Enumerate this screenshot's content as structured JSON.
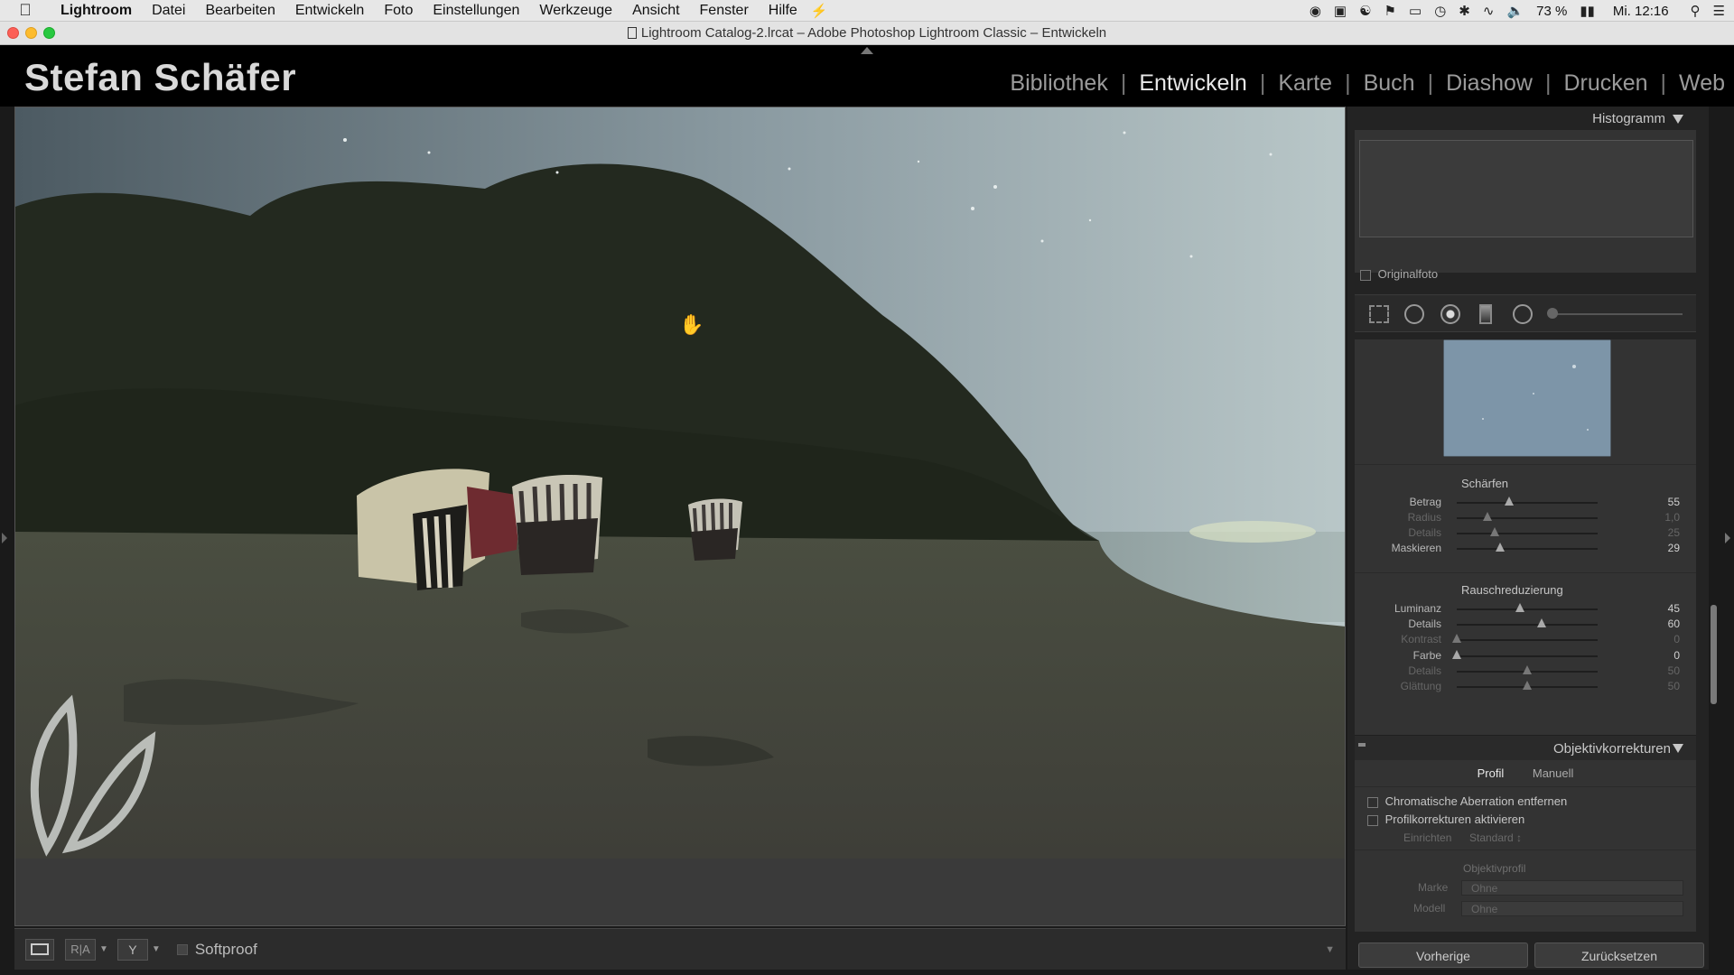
{
  "menubar": {
    "app_name": "Lightroom",
    "items": [
      "Datei",
      "Bearbeiten",
      "Entwickeln",
      "Foto",
      "Einstellungen",
      "Werkzeuge",
      "Ansicht",
      "Fenster",
      "Hilfe"
    ],
    "battery": "73 %",
    "clock": "Mi. 12:16"
  },
  "window": {
    "title": "Lightroom Catalog-2.lrcat – Adobe Photoshop Lightroom Classic – Entwickeln"
  },
  "identity_plate": "Stefan Schäfer",
  "modules": [
    {
      "label": "Bibliothek",
      "active": false
    },
    {
      "label": "Entwickeln",
      "active": true
    },
    {
      "label": "Karte",
      "active": false
    },
    {
      "label": "Buch",
      "active": false
    },
    {
      "label": "Diashow",
      "active": false
    },
    {
      "label": "Drucken",
      "active": false
    },
    {
      "label": "Web",
      "active": false
    }
  ],
  "toolbar": {
    "softproof_label": "Softproof",
    "compare_label": "R|A"
  },
  "histogram": {
    "title": "Histogramm",
    "original_photo_label": "Originalfoto"
  },
  "detail": {
    "sharpen": {
      "title": "Schärfen",
      "sliders": [
        {
          "label": "Betrag",
          "value": "55",
          "pos": 0.37,
          "dim": false
        },
        {
          "label": "Radius",
          "value": "1,0",
          "pos": 0.22,
          "dim": true
        },
        {
          "label": "Details",
          "value": "25",
          "pos": 0.27,
          "dim": true
        },
        {
          "label": "Maskieren",
          "value": "29",
          "pos": 0.31,
          "dim": false
        }
      ]
    },
    "noise": {
      "title": "Rauschreduzierung",
      "sliders": [
        {
          "label": "Luminanz",
          "value": "45",
          "pos": 0.45,
          "dim": false
        },
        {
          "label": "Details",
          "value": "60",
          "pos": 0.6,
          "dim": false
        },
        {
          "label": "Kontrast",
          "value": "0",
          "pos": 0.0,
          "dim": true
        }
      ],
      "color_sliders": [
        {
          "label": "Farbe",
          "value": "0",
          "pos": 0.0,
          "dim": false
        },
        {
          "label": "Details",
          "value": "50",
          "pos": 0.5,
          "dim": true
        },
        {
          "label": "Glättung",
          "value": "50",
          "pos": 0.5,
          "dim": true
        }
      ]
    }
  },
  "lens": {
    "title": "Objektivkorrekturen",
    "tabs": [
      {
        "label": "Profil",
        "active": true
      },
      {
        "label": "Manuell",
        "active": false
      }
    ],
    "remove_ca_label": "Chromatische Aberration entfernen",
    "enable_profile_label": "Profilkorrekturen aktivieren",
    "setup_label": "Einrichten",
    "setup_value": "Standard",
    "profile_title": "Objektivprofil",
    "make_label": "Marke",
    "make_value": "Ohne",
    "model_label": "Modell",
    "model_value": "Ohne"
  },
  "buttons": {
    "previous": "Vorherige",
    "reset": "Zurücksetzen"
  }
}
